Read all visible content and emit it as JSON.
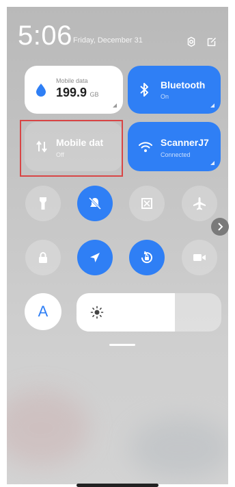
{
  "status": {
    "time": "5:06",
    "date": "Friday, December 31"
  },
  "tiles": {
    "data_usage": {
      "label": "Mobile data",
      "value": "199.9",
      "unit": "GB"
    },
    "bluetooth": {
      "title": "Bluetooth",
      "status": "On"
    },
    "mobile_data": {
      "title": "Mobile dat",
      "status": "Off"
    },
    "wifi": {
      "title": "ScannerJ7",
      "status": "Connected"
    }
  },
  "toggles": {
    "row1": [
      {
        "name": "flashlight",
        "state": "off",
        "icon": "flashlight-icon"
      },
      {
        "name": "silent",
        "state": "on",
        "icon": "bell-off-icon"
      },
      {
        "name": "screenshot",
        "state": "off",
        "icon": "screenshot-icon"
      },
      {
        "name": "airplane",
        "state": "off",
        "icon": "airplane-icon"
      }
    ],
    "row2": [
      {
        "name": "lock",
        "state": "off",
        "icon": "lock-icon"
      },
      {
        "name": "location",
        "state": "on",
        "icon": "location-arrow-icon"
      },
      {
        "name": "auto-rotate",
        "state": "on",
        "icon": "rotate-lock-icon"
      },
      {
        "name": "screen-record",
        "state": "off",
        "icon": "video-icon"
      }
    ]
  },
  "auto_brightness": {
    "label": "A"
  },
  "brightness": {
    "level": 0.68
  },
  "colors": {
    "accent": "#2f7ff5",
    "tile_off": "#c0c0c0",
    "highlight": "#d84545"
  }
}
